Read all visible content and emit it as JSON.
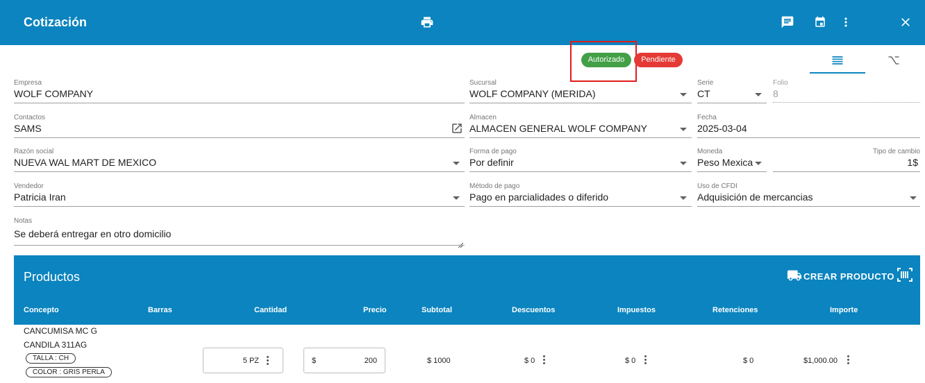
{
  "header": {
    "title": "Cotización",
    "icons": [
      "printer-icon",
      "comment-icon",
      "calendar-icon",
      "more-vert-icon",
      "close-icon"
    ]
  },
  "status": {
    "autorizado": "Autorizado",
    "pendiente": "Pendiente",
    "colors": {
      "autorizado": "#43a047",
      "pendiente": "#e53935",
      "highlight": "#e11b1b"
    }
  },
  "form": {
    "empresa": {
      "label": "Empresa",
      "value": "WOLF COMPANY"
    },
    "sucursal": {
      "label": "Sucursal",
      "value": "WOLF COMPANY (MERIDA)"
    },
    "serie": {
      "label": "Serie",
      "value": "CT"
    },
    "folio": {
      "label": "Folio",
      "value": "8"
    },
    "contactos": {
      "label": "Contactos",
      "value": "SAMS"
    },
    "almacen": {
      "label": "Almacen",
      "value": "ALMACEN GENERAL WOLF COMPANY"
    },
    "fecha": {
      "label": "Fecha",
      "value": "2025-03-04"
    },
    "razon_social": {
      "label": "Razón social",
      "value": "NUEVA WAL MART DE MEXICO"
    },
    "forma_pago": {
      "label": "Forma de pago",
      "value": "Por definir"
    },
    "moneda": {
      "label": "Moneda",
      "value": "Peso Mexica"
    },
    "tipo_cambio": {
      "label": "Tipo de cambio",
      "value": "1$"
    },
    "vendedor": {
      "label": "Vendedor",
      "value": "Patricia Iran"
    },
    "metodo_pago": {
      "label": "Método de pago",
      "value": "Pago en parcialidades o diferido"
    },
    "uso_cfdi": {
      "label": "Uso de CFDI",
      "value": "Adquisición de mercancias"
    },
    "notas": {
      "label": "Notas",
      "value": "Se deberá entregar en otro domicilio"
    }
  },
  "productos": {
    "title": "Productos",
    "crear_label": "CREAR PRODUCTO",
    "columns": [
      "Concepto",
      "Barras",
      "Cantidad",
      "Precio",
      "Subtotal",
      "Descuentos",
      "Impuestos",
      "Retenciones",
      "Importe"
    ],
    "rows": [
      {
        "concepto_line1": "CANCUMISA MC G",
        "concepto_line2": "CANDILA 311AG",
        "chips": [
          "TALLA : CH",
          "COLOR : GRIS PERLA"
        ],
        "cantidad": "5 PZ",
        "precio_currency": "$",
        "precio": "200",
        "subtotal": "$ 1000",
        "descuentos": "$ 0",
        "impuestos": "$ 0",
        "retenciones": "$ 0",
        "importe": "$1,000.00"
      }
    ]
  }
}
